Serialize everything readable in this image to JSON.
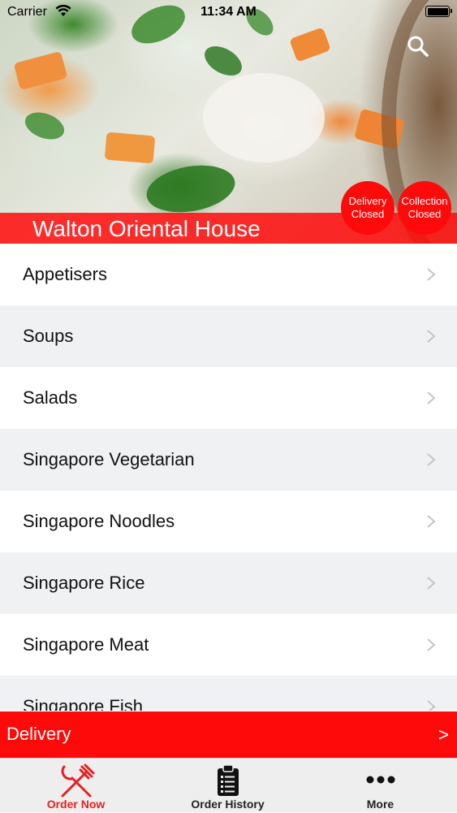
{
  "status_bar": {
    "carrier": "Carrier",
    "time": "11:34 AM"
  },
  "header": {
    "restaurant_name": "Walton Oriental House",
    "delivery_status": {
      "line1": "Delivery",
      "line2": "Closed"
    },
    "collection_status": {
      "line1": "Collection",
      "line2": "Closed"
    },
    "search_icon": "search-icon"
  },
  "categories": [
    {
      "label": "Appetisers"
    },
    {
      "label": "Soups"
    },
    {
      "label": "Salads"
    },
    {
      "label": "Singapore Vegetarian"
    },
    {
      "label": "Singapore Noodles"
    },
    {
      "label": "Singapore Rice"
    },
    {
      "label": "Singapore Meat"
    },
    {
      "label": "Singapore Fish"
    }
  ],
  "delivery_bar": {
    "label": "Delivery",
    "arrow": ">"
  },
  "tabs": [
    {
      "label": "Order Now",
      "icon": "fork-knife-icon",
      "active": true
    },
    {
      "label": "Order History",
      "icon": "clipboard-list-icon",
      "active": false
    },
    {
      "label": "More",
      "icon": "more-dots-icon",
      "active": false
    }
  ],
  "colors": {
    "accent": "#ff0a0a",
    "active_tab": "#e62020",
    "row_alt": "#eff1f3",
    "tab_bar_bg": "#eeeeee"
  }
}
